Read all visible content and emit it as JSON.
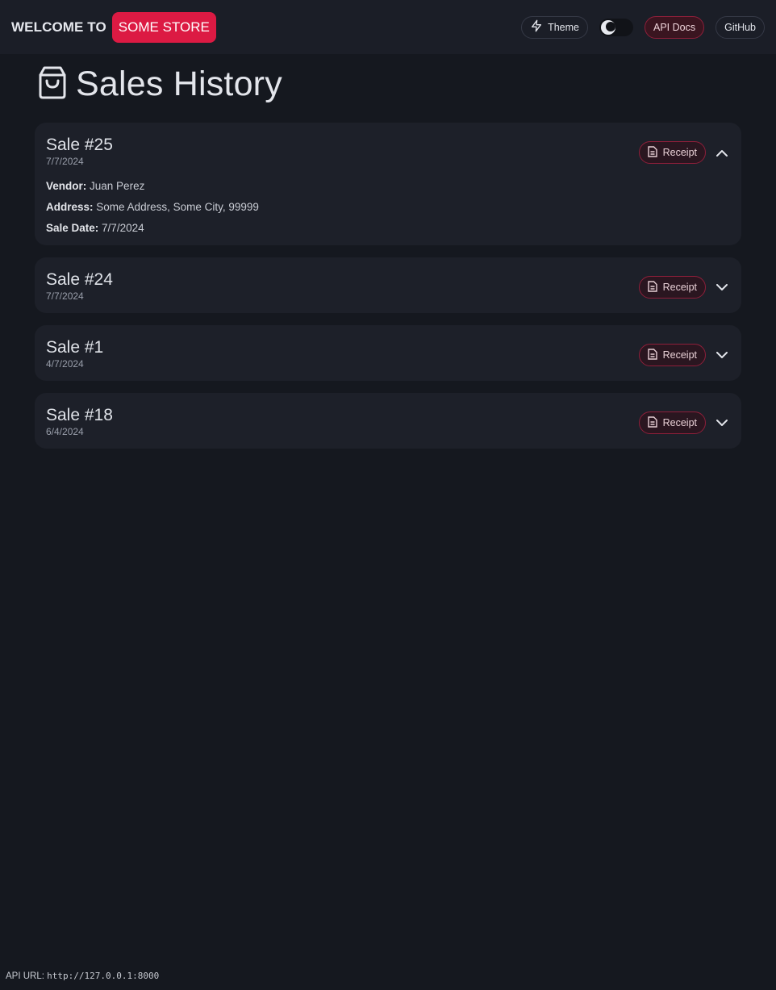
{
  "header": {
    "brand_prefix": "WELCOME TO",
    "brand_name": "SOME STORE",
    "nav": {
      "theme_label": "Theme",
      "api_docs_label": "API Docs",
      "github_label": "GitHub"
    },
    "dark_mode_toggle": "on",
    "accent_color": "#dc1a43"
  },
  "page": {
    "title": "Sales History",
    "title_icon": "shopping-bag-icon"
  },
  "sales": [
    {
      "title": "Sale #25",
      "date": "7/7/2024",
      "receipt_label": "Receipt",
      "expanded": true,
      "details": {
        "vendor_label": "Vendor:",
        "vendor": "Juan Perez",
        "address_label": "Address:",
        "address": "Some Address, Some City, 99999",
        "sale_date_label": "Sale Date:",
        "sale_date": "7/7/2024"
      }
    },
    {
      "title": "Sale #24",
      "date": "7/7/2024",
      "receipt_label": "Receipt",
      "expanded": false
    },
    {
      "title": "Sale #1",
      "date": "4/7/2024",
      "receipt_label": "Receipt",
      "expanded": false
    },
    {
      "title": "Sale #18",
      "date": "6/4/2024",
      "receipt_label": "Receipt",
      "expanded": false
    }
  ],
  "footer": {
    "api_url_label": "API URL:",
    "api_url": "http://127.0.0.1:8000"
  }
}
